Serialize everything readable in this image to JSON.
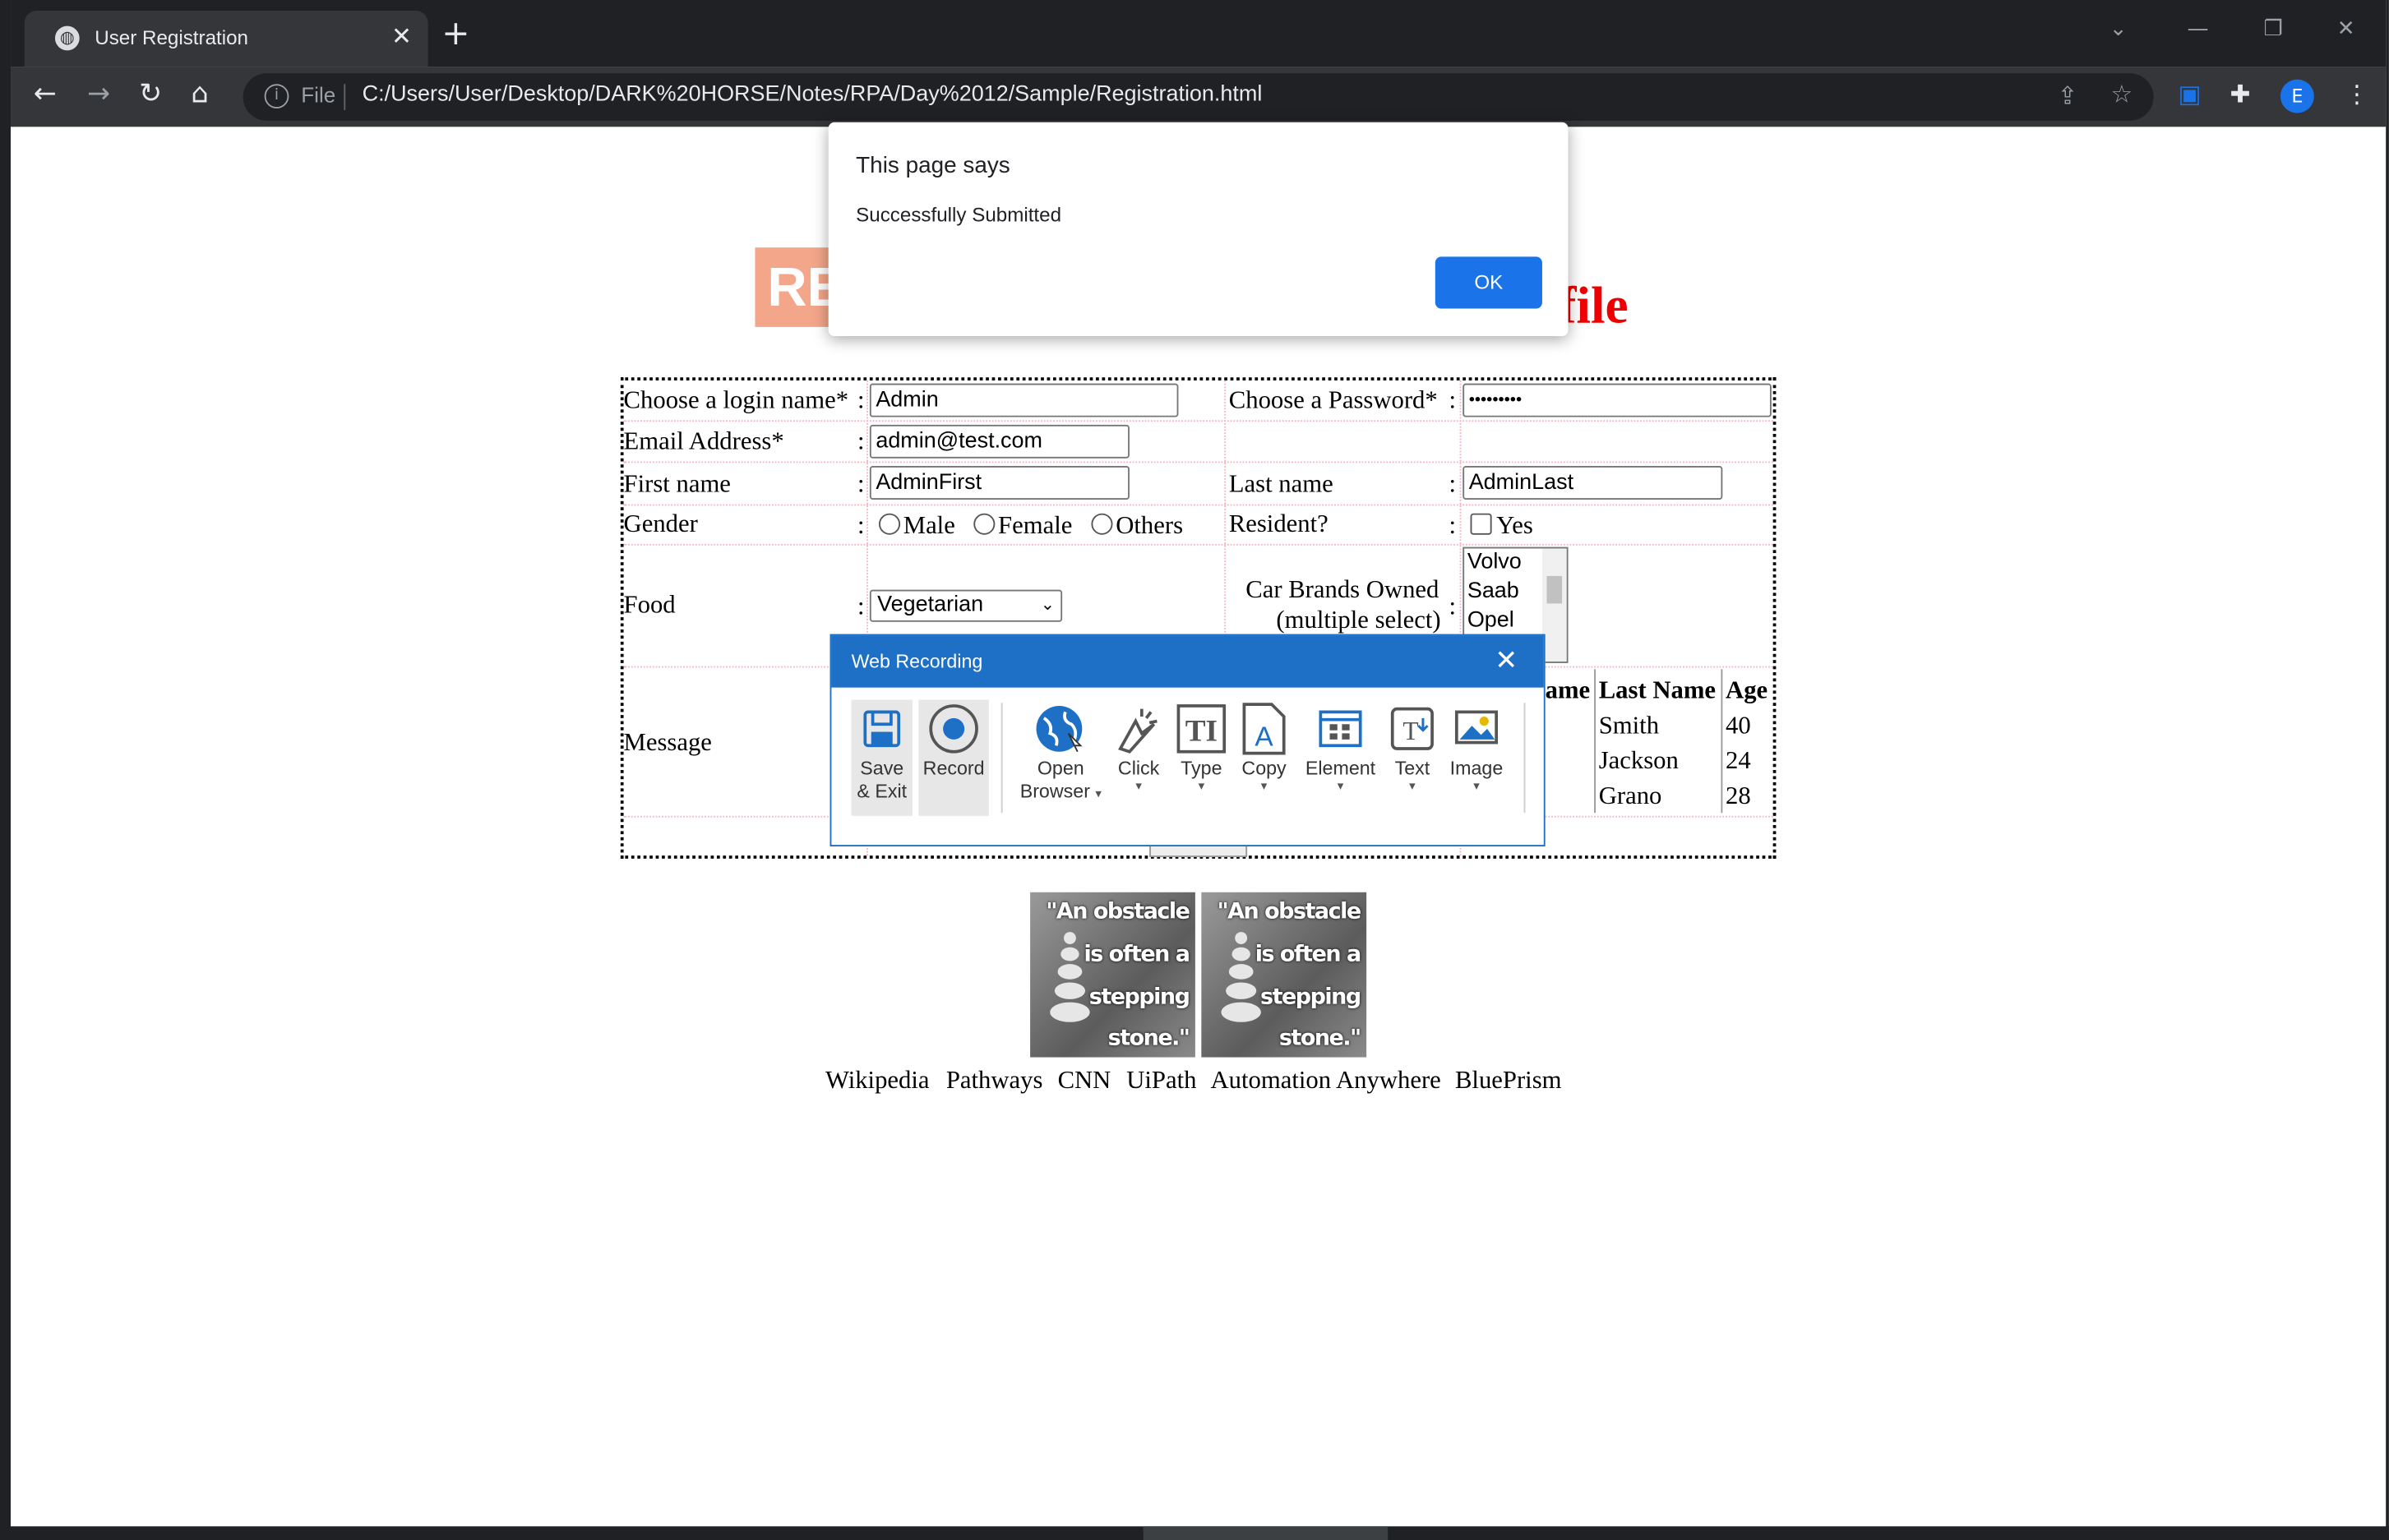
{
  "browser": {
    "tab_title": "User Registration",
    "address_scheme": "File",
    "url": "C:/Users/User/Desktop/DARK%20HORSE/Notes/RPA/Day%2012/Sample/Registration.html",
    "profile_initial": "E"
  },
  "page": {
    "logo_text": "RE",
    "title": "file",
    "form": {
      "login_label": "Choose a login name*",
      "login_value": "Admin",
      "password_label": "Choose a Password*",
      "password_value": "•••••••••",
      "email_label": "Email Address*",
      "email_value": "admin@test.com",
      "first_name_label": "First name",
      "first_name_value": "AdminFirst",
      "last_name_label": "Last name",
      "last_name_value": "AdminLast",
      "gender_label": "Gender",
      "gender_options": [
        "Male",
        "Female",
        "Others"
      ],
      "resident_label": "Resident?",
      "resident_option": "Yes",
      "food_label": "Food",
      "food_value": "Vegetarian",
      "car_label_line1": "Car Brands Owned",
      "car_label_line2": "(multiple select)",
      "car_options": [
        "Volvo",
        "Saab",
        "Opel"
      ],
      "message_label": "Message",
      "colon": ":"
    },
    "table": {
      "headers": [
        "ame",
        "Last Name",
        "Age"
      ],
      "rows": [
        {
          "last": "Smith",
          "age": "40"
        },
        {
          "last": "Jackson",
          "age": "24"
        },
        {
          "last": "Grano",
          "age": "28"
        }
      ]
    },
    "quote": {
      "lines": [
        "\"An obstacle",
        "is often a",
        "stepping",
        "stone.\""
      ]
    },
    "links": [
      "Wikipedia",
      "Pathways",
      "CNN",
      "UiPath",
      "Automation Anywhere",
      "BluePrism"
    ]
  },
  "alert": {
    "title": "This page says",
    "message": "Successfully Submitted",
    "ok_label": "OK"
  },
  "recorder": {
    "title": "Web Recording",
    "tools": [
      {
        "line1": "Save",
        "line2": "& Exit"
      },
      {
        "line1": "Record"
      },
      {
        "line1": "Open",
        "line2": "Browser"
      },
      {
        "line1": "Click"
      },
      {
        "line1": "Type"
      },
      {
        "line1": "Copy"
      },
      {
        "line1": "Element"
      },
      {
        "line1": "Text"
      },
      {
        "line1": "Image"
      }
    ],
    "accent": "#1e6fc6"
  }
}
